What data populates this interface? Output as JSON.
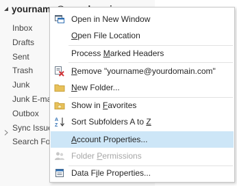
{
  "account": {
    "name": "yourname@yourdomain.com"
  },
  "folders": [
    {
      "label": "Inbox",
      "has_children": false
    },
    {
      "label": "Drafts",
      "has_children": false
    },
    {
      "label": "Sent",
      "has_children": false
    },
    {
      "label": "Trash",
      "has_children": false
    },
    {
      "label": "Junk",
      "has_children": false
    },
    {
      "label": "Junk E-mail",
      "has_children": false
    },
    {
      "label": "Outbox",
      "has_children": false
    },
    {
      "label": "Sync Issues",
      "has_children": true
    },
    {
      "label": "Search Folders",
      "has_children": false
    }
  ],
  "menu": {
    "items": [
      {
        "label": "Open in New Window",
        "icon": "new-window-icon",
        "accel": ""
      },
      {
        "label": "Open File Location",
        "icon": "",
        "accel": "O"
      },
      {
        "label": "Process Marked Headers",
        "icon": "",
        "accel": "M"
      },
      {
        "label": "Remove \"yourname@yourdomain.com\"",
        "icon": "remove-account-icon",
        "accel": "R"
      },
      {
        "label": "New Folder...",
        "icon": "folder-icon",
        "accel": "N"
      },
      {
        "label": "Show in Favorites",
        "icon": "favorites-icon",
        "accel": "F"
      },
      {
        "label": "Sort Subfolders A to Z",
        "icon": "sort-az-icon",
        "accel": "Z"
      },
      {
        "label": "Account Properties...",
        "icon": "",
        "accel": "A",
        "state": "highlighted"
      },
      {
        "label": "Folder Permissions",
        "icon": "permissions-icon",
        "accel": "P",
        "state": "disabled"
      },
      {
        "label": "Data File Properties...",
        "icon": "data-file-icon",
        "accel": "i"
      }
    ]
  },
  "colors": {
    "highlight": "#cde6f7",
    "disabled_text": "#a6a6a6",
    "remove_red": "#d13438",
    "folder_yellow": "#e8c15a"
  }
}
